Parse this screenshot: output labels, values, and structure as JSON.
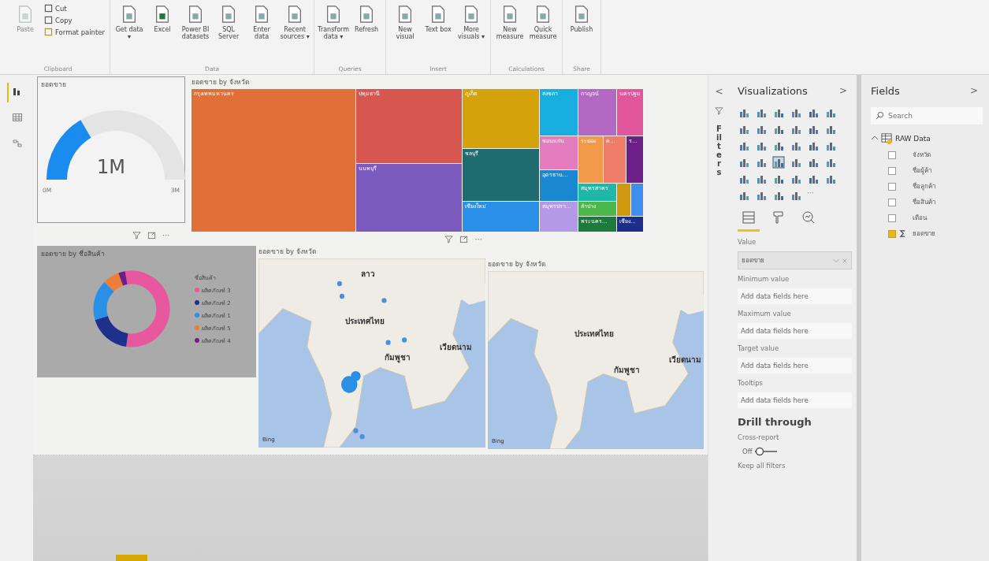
{
  "ribbon": [
    {
      "label": "Clipboard",
      "buttons": [
        {
          "label": "Paste",
          "kind": "large",
          "disabled": true
        },
        {
          "label": "Cut",
          "kind": "small",
          "disabled": false
        },
        {
          "label": "Copy",
          "kind": "small",
          "disabled": false
        },
        {
          "label": "Format painter",
          "kind": "small",
          "disabled": false
        }
      ]
    },
    {
      "label": "Data",
      "buttons": [
        {
          "label": "Get data ▾",
          "kind": "large",
          "disabled": false
        },
        {
          "label": "Excel",
          "kind": "large",
          "disabled": false
        },
        {
          "label": "Power BI datasets",
          "kind": "large",
          "disabled": false
        },
        {
          "label": "SQL Server",
          "kind": "large",
          "disabled": false
        },
        {
          "label": "Enter data",
          "kind": "large",
          "disabled": false
        },
        {
          "label": "Recent sources ▾",
          "kind": "large",
          "disabled": false
        }
      ]
    },
    {
      "label": "Queries",
      "buttons": [
        {
          "label": "Transform data ▾",
          "kind": "large",
          "disabled": false
        },
        {
          "label": "Refresh",
          "kind": "large",
          "disabled": false
        }
      ]
    },
    {
      "label": "Insert",
      "buttons": [
        {
          "label": "New visual",
          "kind": "large",
          "disabled": false
        },
        {
          "label": "Text box",
          "kind": "large",
          "disabled": false
        },
        {
          "label": "More visuals ▾",
          "kind": "large",
          "disabled": false
        }
      ]
    },
    {
      "label": "Calculations",
      "buttons": [
        {
          "label": "New measure",
          "kind": "large",
          "disabled": false
        },
        {
          "label": "Quick measure",
          "kind": "large",
          "disabled": false
        }
      ]
    },
    {
      "label": "Share",
      "buttons": [
        {
          "label": "Publish",
          "kind": "large",
          "disabled": false
        }
      ]
    }
  ],
  "left_nav": [
    {
      "selected": true
    },
    {
      "selected": false
    },
    {
      "selected": false
    }
  ],
  "gauge": {
    "title": "ยอดขาย",
    "value": "1M",
    "min": "0M",
    "max": "3M",
    "level": 0.33
  },
  "visual_header_more": "···",
  "treemap": {
    "title": "ยอดขาย by จังหวัด",
    "tiles": [
      {
        "label": "กรุงเทพมหานคร",
        "color": "#e07038"
      },
      {
        "label": "ปทุมธานี",
        "color": "#d85650"
      },
      {
        "label": "นนทบุรี",
        "color": "#7a5bbd"
      },
      {
        "label": "ภูเก็ต",
        "color": "#d4a30c"
      },
      {
        "label": "ชลบุรี",
        "color": "#1e6b70"
      },
      {
        "label": "เชียงใหม่",
        "color": "#2a8fe6"
      },
      {
        "label": "สงขลา",
        "color": "#18aee0"
      },
      {
        "label": "กาญจน์",
        "color": "#b368c4"
      },
      {
        "label": "นครปฐม",
        "color": "#e2569e"
      },
      {
        "label": "ขอนแก่น",
        "color": "#e67cc0"
      },
      {
        "label": "อุดรธาน...",
        "color": "#1a88d0"
      },
      {
        "label": "สมุทรปรา...",
        "color": "#b49ae6"
      },
      {
        "label": "ระยอง",
        "color": "#f39a4a"
      },
      {
        "label": "ต...",
        "color": "#f07c6c"
      },
      {
        "label": "ร...",
        "color": "#6c1f86"
      },
      {
        "label": "สมุทรสาคร",
        "color": "#1fb8a8"
      },
      {
        "label": "ลำปาง",
        "color": "#4cb84c"
      },
      {
        "label": "พระนคร...",
        "color": "#1c7a3c"
      },
      {
        "color": "#d09a10"
      },
      {
        "color": "#3e8ef0"
      },
      {
        "label": "เชียง...",
        "color": "#1c2e8a"
      }
    ]
  },
  "donut": {
    "title": "ยอดขาย by ชื่อสินค้า",
    "legend_title": "ชื่อสินค้า",
    "legend": [
      {
        "label": "ผลิตภัณฑ์ 3",
        "color": "#e6579e"
      },
      {
        "label": "ผลิตภัณฑ์ 2",
        "color": "#1f2f8c"
      },
      {
        "label": "ผลิตภัณฑ์ 1",
        "color": "#2a8fe6"
      },
      {
        "label": "ผลิตภัณฑ์ 5",
        "color": "#ef7d3a"
      },
      {
        "label": "ผลิตภัณฑ์ 4",
        "color": "#6c1f86"
      }
    ]
  },
  "maps": [
    {
      "title": "ยอดขาย by จังหวัด",
      "labels": [
        "ลาว",
        "ประเทศไทย",
        "เวียดนาม",
        "กัมพูชา"
      ],
      "attribution": "Bing",
      "bubbles": true
    },
    {
      "title": "ยอดขาย by จังหวัด",
      "labels": [
        "ประเทศไทย",
        "เวียดนาม",
        "กัมพูชา"
      ],
      "attribution": "Bing",
      "bubbles": false
    }
  ],
  "filters_pane": {
    "label": "Filters",
    "collapse": "<"
  },
  "visualizations": {
    "title": "Visualizations",
    "expand": ">",
    "more": "···",
    "icons": [
      {
        "selected": false
      },
      {
        "selected": false
      },
      {
        "selected": false
      },
      {
        "selected": false
      },
      {
        "selected": false
      },
      {
        "selected": false
      },
      {
        "selected": false
      },
      {
        "selected": false
      },
      {
        "selected": false
      },
      {
        "selected": false
      },
      {
        "selected": false
      },
      {
        "selected": false
      },
      {
        "selected": false
      },
      {
        "selected": false
      },
      {
        "selected": false
      },
      {
        "selected": false
      },
      {
        "selected": false
      },
      {
        "selected": false
      },
      {
        "selected": false
      },
      {
        "selected": false
      },
      {
        "selected": true
      },
      {
        "selected": false
      },
      {
        "selected": false
      },
      {
        "selected": false
      },
      {
        "selected": false
      },
      {
        "selected": false
      },
      {
        "selected": false
      },
      {
        "selected": false
      },
      {
        "selected": false
      },
      {
        "selected": false
      },
      {
        "selected": false
      },
      {
        "selected": false
      },
      {
        "selected": false
      },
      {
        "selected": false
      }
    ],
    "pane_tabs": [
      {
        "selected": true
      },
      {
        "selected": false
      },
      {
        "selected": false
      }
    ],
    "wells": [
      {
        "label": "Value",
        "field": "ยอดขาย"
      },
      {
        "label": "Minimum value",
        "placeholder": "Add data fields here"
      },
      {
        "label": "Maximum value",
        "placeholder": "Add data fields here"
      },
      {
        "label": "Target value",
        "placeholder": "Add data fields here"
      },
      {
        "label": "Tooltips",
        "placeholder": "Add data fields here"
      }
    ],
    "drill_title": "Drill through",
    "cross_report": "Cross-report",
    "toggle": {
      "label": "Off",
      "on": false
    },
    "keep_filters": "Keep all filters"
  },
  "fields": {
    "title": "Fields",
    "expand": ">",
    "search": {
      "placeholder": "Search"
    },
    "tables": [
      {
        "name": "RAW Data",
        "expanded": true,
        "children": [
          {
            "name": "จังหวัด",
            "checked": false,
            "measure": false
          },
          {
            "name": "ชื่อผู้ค้า",
            "checked": false,
            "measure": false
          },
          {
            "name": "ชื่อลูกค้า",
            "checked": false,
            "measure": false
          },
          {
            "name": "ชื่อสินค้า",
            "checked": false,
            "measure": false
          },
          {
            "name": "เดือน",
            "checked": false,
            "measure": false
          },
          {
            "name": "ยอดขาย",
            "checked": true,
            "measure": true
          }
        ]
      }
    ]
  },
  "pages": [
    {
      "selected": true
    }
  ]
}
